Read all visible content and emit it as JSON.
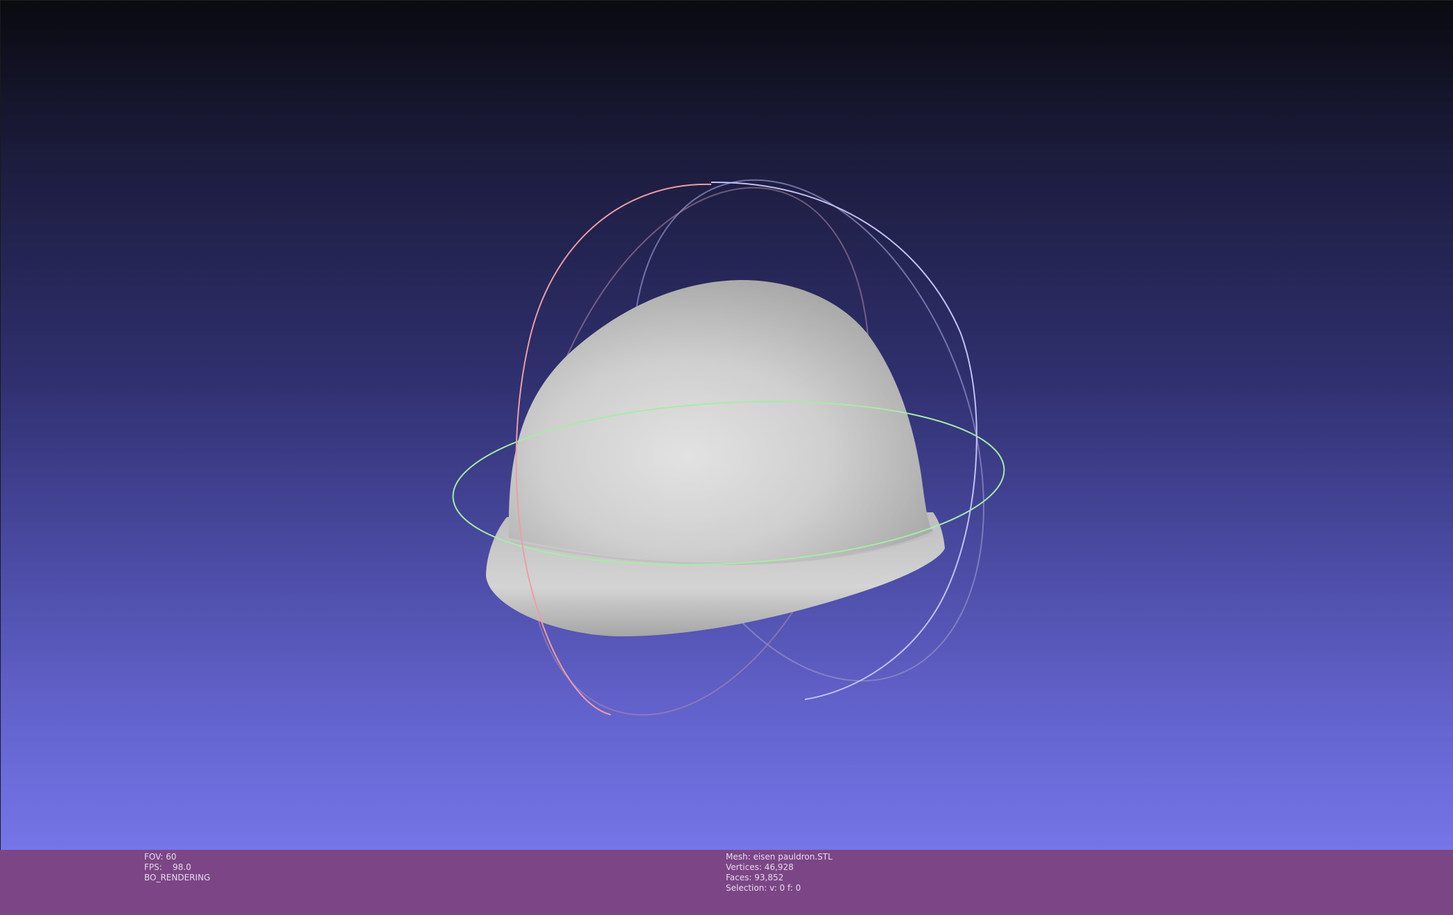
{
  "viewer": {
    "info_left": {
      "fov": "FOV: 60",
      "fps": "FPS:    98.0",
      "render_mode": "BO_RENDERING"
    },
    "info_mesh": {
      "mesh": "Mesh: eisen pauldron.STL",
      "vertices": "Vertices: 46,928",
      "faces": "Faces: 93,852",
      "selection": "Selection: v: 0 f: 0"
    }
  },
  "colors": {
    "background_top": "#0a0a10",
    "background_bottom": "#7575e8",
    "infobar": "#7c4686",
    "mesh": "#cfcfcf",
    "trackball_x": "#e89090",
    "trackball_y": "#9ee89e",
    "trackball_z": "#b0b0f0"
  }
}
